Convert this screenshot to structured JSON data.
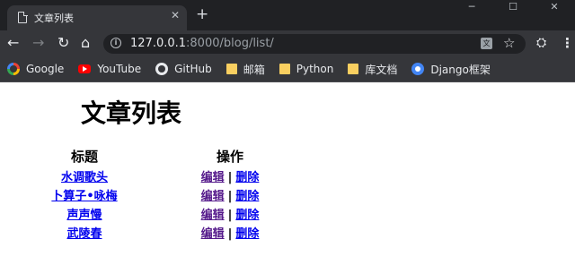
{
  "browser": {
    "tab_title": "文章列表",
    "tab_close": "✕",
    "new_tab": "+",
    "window_controls": [
      "─",
      "☐",
      "✕"
    ],
    "url_host": "127.0.0.1",
    "url_port_path": ":8000/blog/list/",
    "bookmarks": [
      {
        "label": "Google",
        "icon": "google-icon"
      },
      {
        "label": "YouTube",
        "icon": "youtube-icon"
      },
      {
        "label": "GitHub",
        "icon": "github-icon"
      },
      {
        "label": "邮箱",
        "icon": "folder-icon"
      },
      {
        "label": "Python",
        "icon": "folder-icon"
      },
      {
        "label": "库文档",
        "icon": "folder-icon"
      },
      {
        "label": "Django框架",
        "icon": "django-icon"
      }
    ]
  },
  "page": {
    "heading": "文章列表",
    "table": {
      "columns": [
        "标题",
        "操作"
      ],
      "rows": [
        {
          "title": "水调歌头",
          "edit": "编辑",
          "sep": "|",
          "delete": "删除"
        },
        {
          "title": "卜算子•咏梅",
          "edit": "编辑",
          "sep": "|",
          "delete": "删除"
        },
        {
          "title": "声声慢",
          "edit": "编辑",
          "sep": "|",
          "delete": "删除"
        },
        {
          "title": "武陵春",
          "edit": "编辑",
          "sep": "|",
          "delete": "删除"
        }
      ]
    }
  }
}
